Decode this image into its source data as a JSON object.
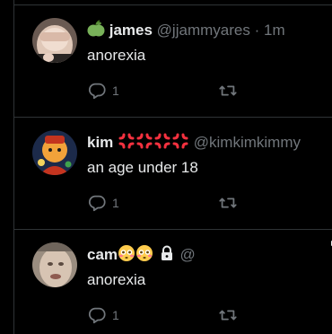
{
  "tweets": [
    {
      "name": "james",
      "name_prefix_emoji": "green-apple",
      "handle": "@jjammyares",
      "separator": "·",
      "time": "1m",
      "text": "anorexia",
      "reply_count": "1",
      "avatar": "person-covering-face-avatar"
    },
    {
      "name": "kim",
      "name_suffix_emojis": [
        "anger-symbol",
        "anger-symbol",
        "anger-symbol",
        "anger-symbol"
      ],
      "handle": "@kimkimkimmy",
      "text": "an age under 18",
      "reply_count": "1",
      "avatar": "illustrated-character-avatar"
    },
    {
      "name": "cam",
      "name_suffix_emojis": [
        "flushed-face",
        "flushed-face"
      ],
      "protected_icon": "lock-icon",
      "handle": "@",
      "text": "anorexia",
      "reply_count": "1",
      "avatar": "blurred-face-avatar"
    }
  ],
  "colors": {
    "background": "#000000",
    "primary_text": "#e7e9ea",
    "secondary_text": "#71767b",
    "divider": "#2f3336",
    "anger_red": "#f4313f",
    "apple_green": "#78b159",
    "flushed_yellow": "#ffcc4d"
  },
  "icons": {
    "reply": "reply-bubble-icon",
    "retweet": "retweet-icon"
  }
}
